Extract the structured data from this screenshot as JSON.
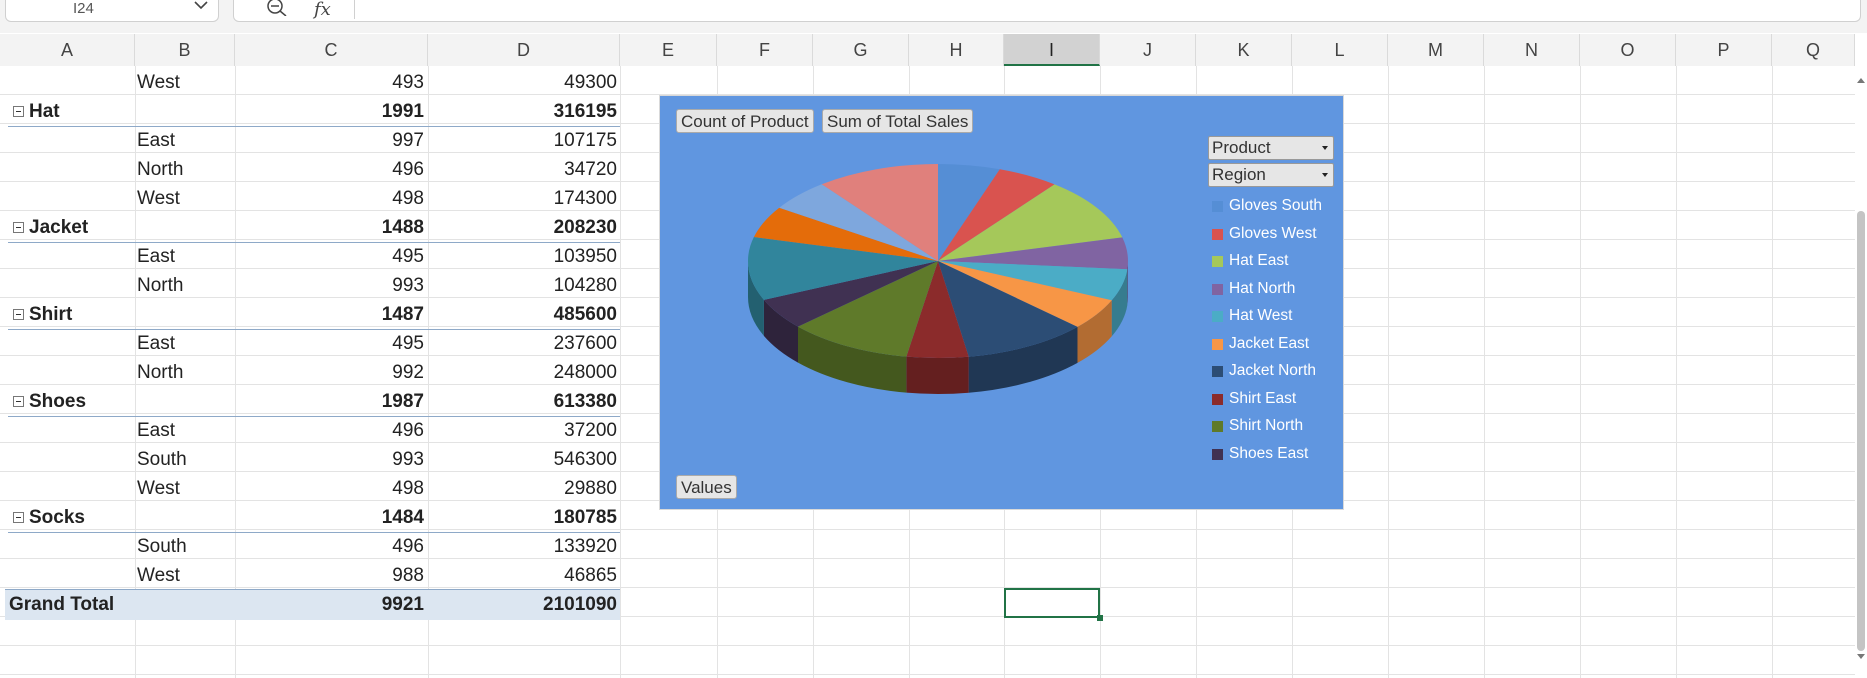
{
  "namebox": {
    "cell_ref": "I24"
  },
  "formula": {
    "fx_label": "fx"
  },
  "columns": [
    "A",
    "B",
    "C",
    "D",
    "E",
    "F",
    "G",
    "H",
    "I",
    "J",
    "K",
    "L",
    "M",
    "N",
    "O",
    "P",
    "Q"
  ],
  "pivot": {
    "rows": [
      {
        "label": "",
        "sub": "West",
        "count": "493",
        "sum": "49300",
        "type": "detail"
      },
      {
        "label": "Hat",
        "sub": "",
        "count": "1991",
        "sum": "316195",
        "type": "group"
      },
      {
        "label": "",
        "sub": "East",
        "count": "997",
        "sum": "107175",
        "type": "detail"
      },
      {
        "label": "",
        "sub": "North",
        "count": "496",
        "sum": "34720",
        "type": "detail"
      },
      {
        "label": "",
        "sub": "West",
        "count": "498",
        "sum": "174300",
        "type": "detail"
      },
      {
        "label": "Jacket",
        "sub": "",
        "count": "1488",
        "sum": "208230",
        "type": "group"
      },
      {
        "label": "",
        "sub": "East",
        "count": "495",
        "sum": "103950",
        "type": "detail"
      },
      {
        "label": "",
        "sub": "North",
        "count": "993",
        "sum": "104280",
        "type": "detail"
      },
      {
        "label": "Shirt",
        "sub": "",
        "count": "1487",
        "sum": "485600",
        "type": "group"
      },
      {
        "label": "",
        "sub": "East",
        "count": "495",
        "sum": "237600",
        "type": "detail"
      },
      {
        "label": "",
        "sub": "North",
        "count": "992",
        "sum": "248000",
        "type": "detail"
      },
      {
        "label": "Shoes",
        "sub": "",
        "count": "1987",
        "sum": "613380",
        "type": "group"
      },
      {
        "label": "",
        "sub": "East",
        "count": "496",
        "sum": "37200",
        "type": "detail"
      },
      {
        "label": "",
        "sub": "South",
        "count": "993",
        "sum": "546300",
        "type": "detail"
      },
      {
        "label": "",
        "sub": "West",
        "count": "498",
        "sum": "29880",
        "type": "detail"
      },
      {
        "label": "Socks",
        "sub": "",
        "count": "1484",
        "sum": "180785",
        "type": "group"
      },
      {
        "label": "",
        "sub": "South",
        "count": "496",
        "sum": "133920",
        "type": "detail"
      },
      {
        "label": "",
        "sub": "West",
        "count": "988",
        "sum": "46865",
        "type": "detail"
      },
      {
        "label": "Grand Total",
        "sub": "",
        "count": "9921",
        "sum": "2101090",
        "type": "total"
      }
    ]
  },
  "chart": {
    "field_buttons": {
      "count": "Count of Product",
      "sum": "Sum of Total Sales",
      "values": "Values"
    },
    "filters": {
      "product": "Product",
      "region": "Region"
    },
    "legend": [
      {
        "label": "Gloves South",
        "color": "#558ed5"
      },
      {
        "label": "Gloves West",
        "color": "#d9534f"
      },
      {
        "label": "Hat East",
        "color": "#a5c85a"
      },
      {
        "label": "Hat North",
        "color": "#8064a2"
      },
      {
        "label": "Hat West",
        "color": "#4bacc6"
      },
      {
        "label": "Jacket East",
        "color": "#f79646"
      },
      {
        "label": "Jacket North",
        "color": "#2c4d75"
      },
      {
        "label": "Shirt East",
        "color": "#8b2b2b"
      },
      {
        "label": "Shirt North",
        "color": "#5f7a2a"
      },
      {
        "label": "Shoes East",
        "color": "#403152"
      }
    ]
  },
  "chart_data": {
    "type": "pie",
    "title": "",
    "categories": [
      "Gloves South",
      "Gloves West",
      "Hat East",
      "Hat North",
      "Hat West",
      "Jacket East",
      "Jacket North",
      "Shirt East",
      "Shirt North",
      "Shoes East",
      "Shoes South",
      "Shoes West",
      "Socks South",
      "Socks West"
    ],
    "values": [
      497,
      494,
      997,
      496,
      498,
      495,
      993,
      495,
      992,
      496,
      993,
      498,
      496,
      988
    ],
    "colors": [
      "#558ed5",
      "#d9534f",
      "#a5c85a",
      "#8064a2",
      "#4bacc6",
      "#f79646",
      "#2c4d75",
      "#8b2b2b",
      "#5f7a2a",
      "#403152",
      "#31859c",
      "#e46c0a",
      "#7ea7dd",
      "#e0807c"
    ],
    "legend_position": "right"
  }
}
